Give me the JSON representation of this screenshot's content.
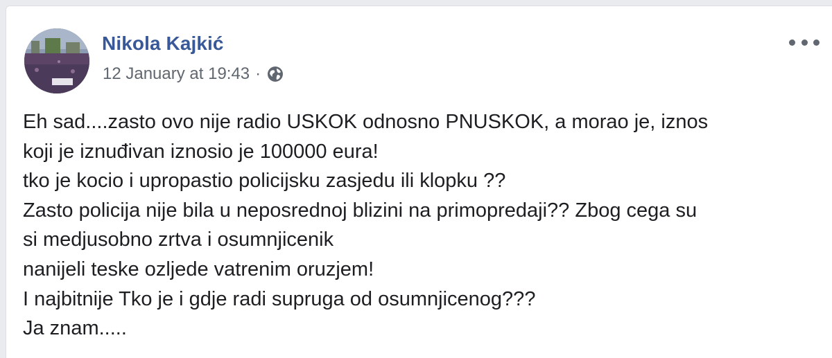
{
  "post": {
    "author": "Nikola Kajkić",
    "timestamp": "12 January at 19:43",
    "separator": "·",
    "privacy_icon": "globe-icon",
    "more_icon": "more-options-icon",
    "lines": [
      "Eh sad....zasto ovo nije radio USKOK odnosno PNUSKOK, a morao je, iznos",
      "koji je iznuđivan iznosio je 100000 eura!",
      "tko je kocio i upropastio policijsku zasjedu ili klopku ??",
      "Zasto policija nije bila u neposrednoj blizini na primopredaji?? Zbog cega su",
      "si medjusobno zrtva i osumnjicenik",
      "nanijeli teske ozljede vatrenim oruzjem!",
      "I najbitnije Tko je i gdje radi supruga od osumnjicenog???",
      "Ja znam....."
    ]
  },
  "colors": {
    "author_name": "#385898",
    "meta_text": "#616770",
    "body_text": "#1c1e21",
    "page_bg": "#e9ebee",
    "card_bg": "#ffffff"
  }
}
